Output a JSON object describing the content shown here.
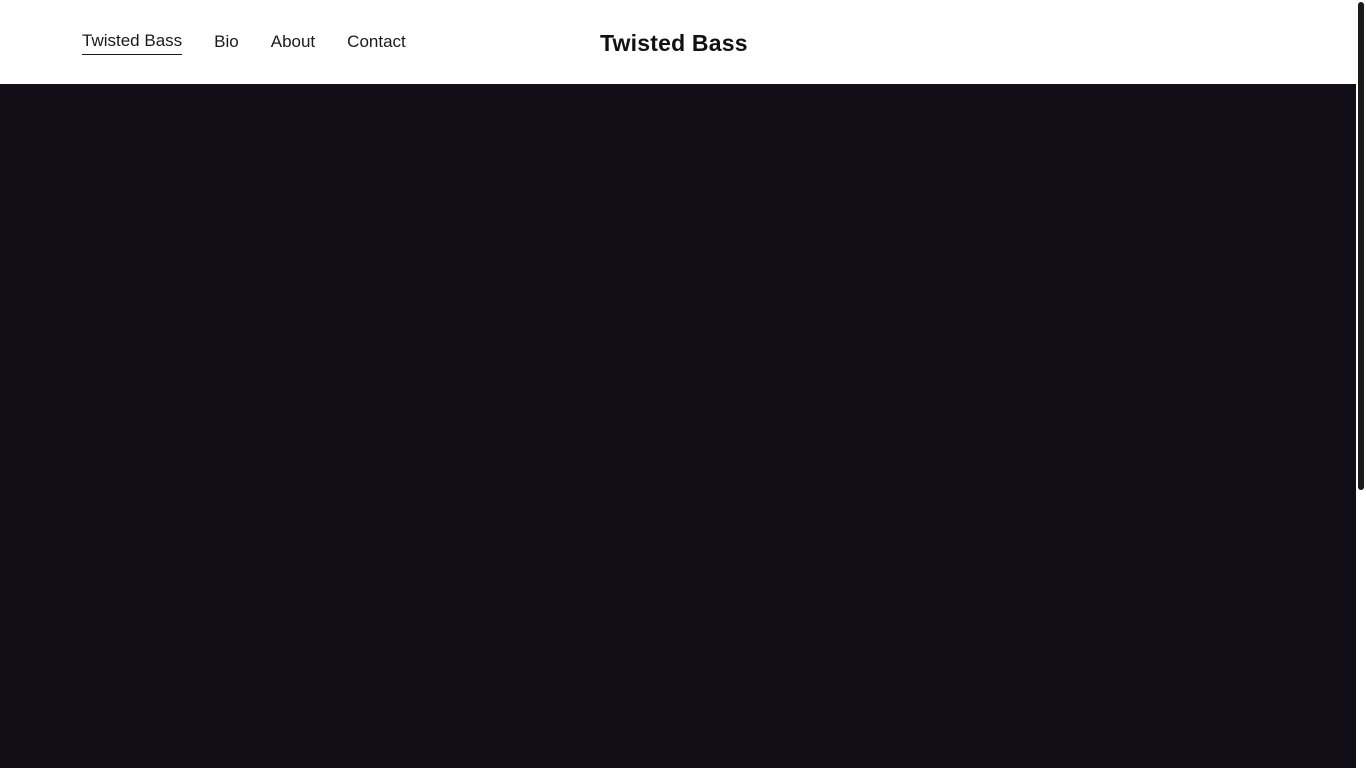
{
  "nav": {
    "items": [
      {
        "label": "Twisted Bass",
        "active": true
      },
      {
        "label": "Bio",
        "active": false
      },
      {
        "label": "About",
        "active": false
      },
      {
        "label": "Contact",
        "active": false
      }
    ]
  },
  "header": {
    "site_title": "Twisted Bass"
  },
  "colors": {
    "hero_background": "#110d17",
    "header_background": "#ffffff",
    "text": "#1a1a1a"
  }
}
